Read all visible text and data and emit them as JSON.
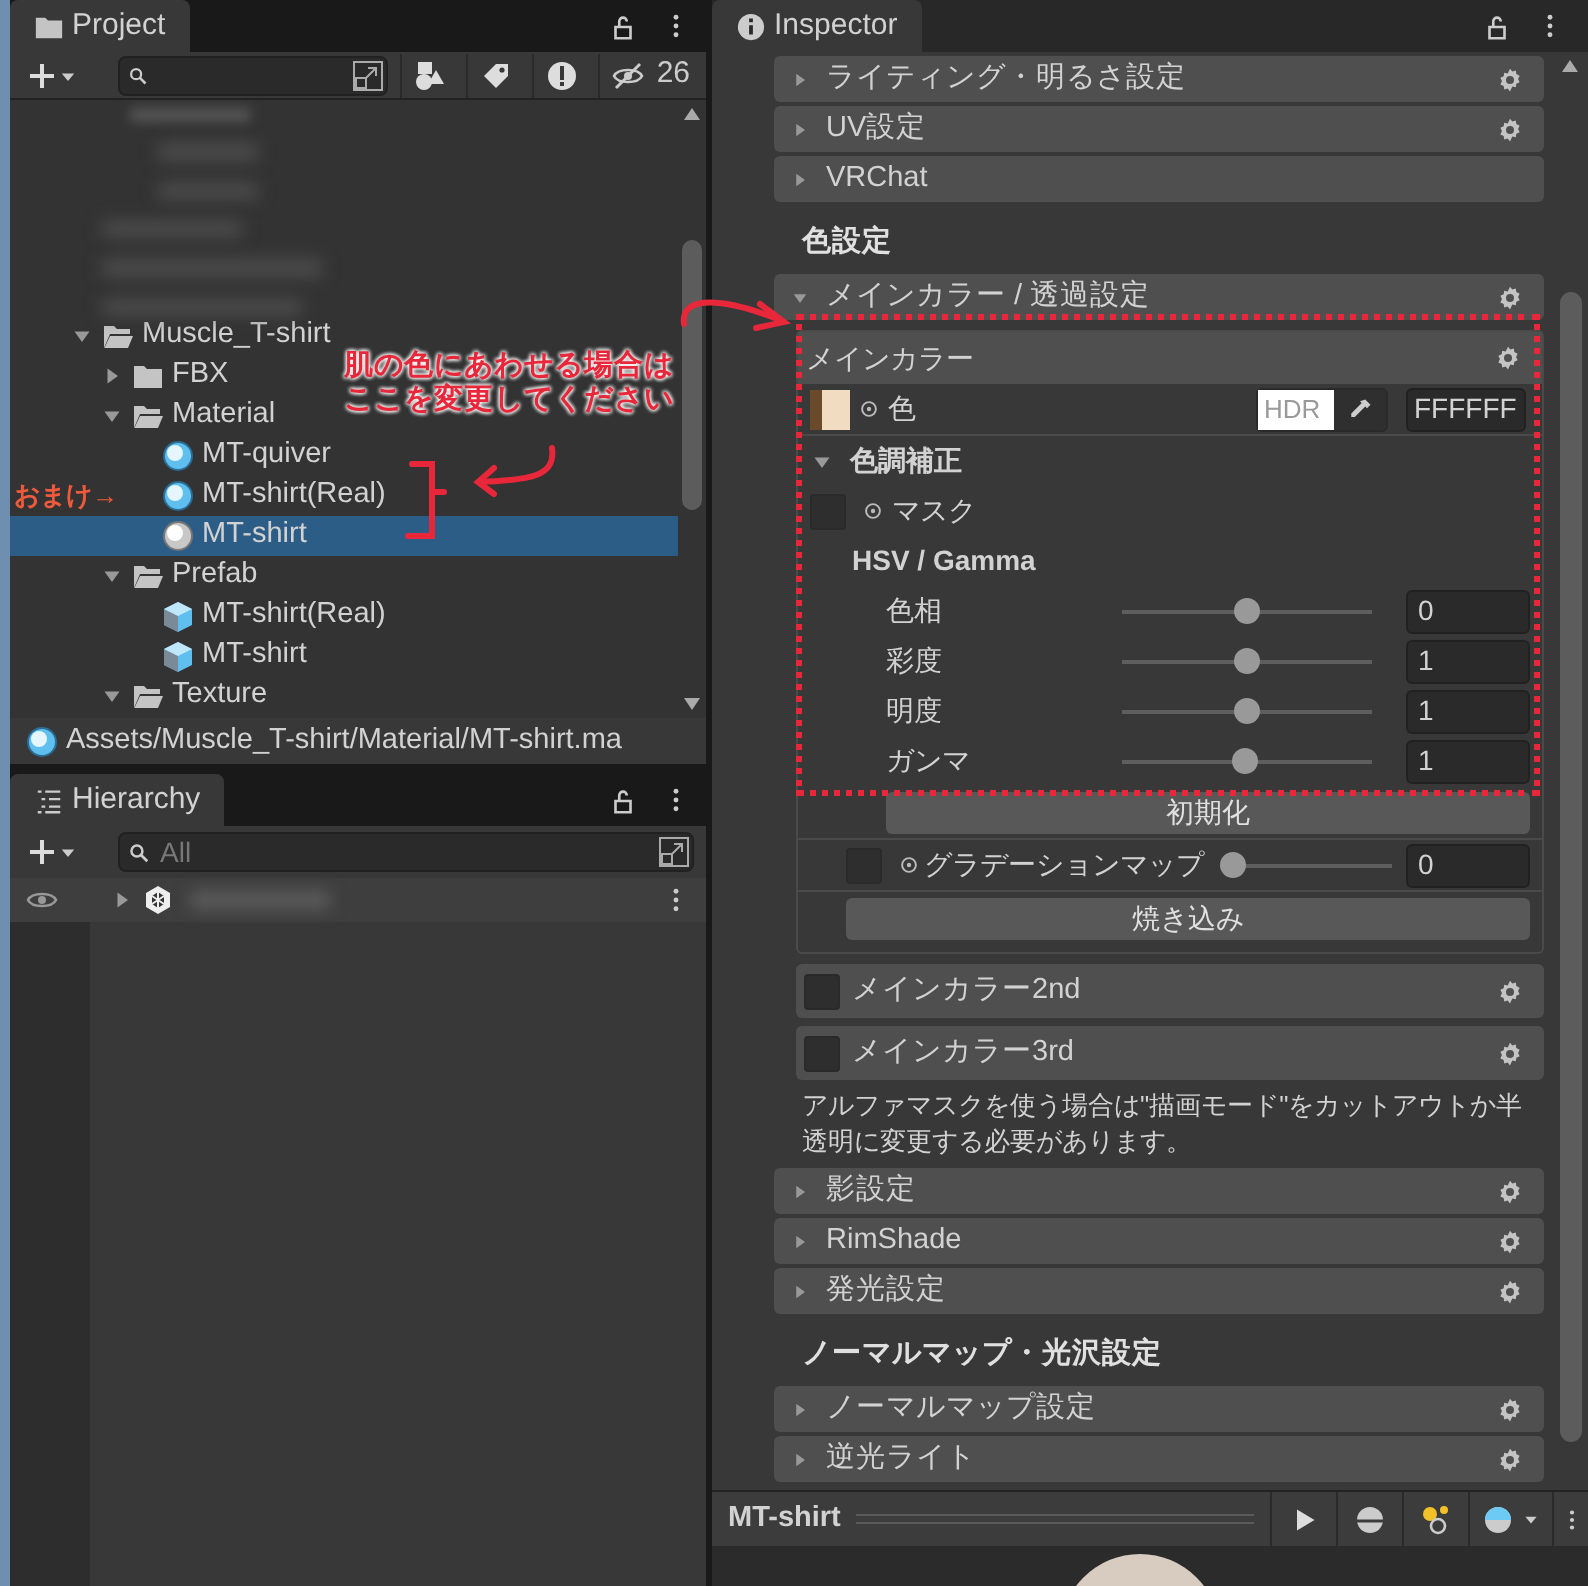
{
  "project_panel": {
    "tab": "Project",
    "hidden_count": "26",
    "tree": [
      {
        "label": "Muscle_T-shirt",
        "kind": "folder",
        "expanded": true,
        "selected": false,
        "children": [
          {
            "label": "FBX",
            "kind": "folder",
            "expanded": false,
            "selected": false
          },
          {
            "label": "Material",
            "kind": "folder",
            "expanded": true,
            "selected": false,
            "children": [
              {
                "label": "MT-quiver",
                "kind": "material",
                "selected": false
              },
              {
                "label": "MT-shirt(Real)",
                "kind": "material",
                "selected": false
              },
              {
                "label": "MT-shirt",
                "kind": "material",
                "selected": true
              }
            ]
          },
          {
            "label": "Prefab",
            "kind": "folder",
            "expanded": true,
            "selected": false,
            "children": [
              {
                "label": "MT-shirt(Real)",
                "kind": "prefab",
                "selected": false
              },
              {
                "label": "MT-shirt",
                "kind": "prefab",
                "selected": false
              }
            ]
          },
          {
            "label": "Texture",
            "kind": "folder",
            "expanded": true,
            "selected": false
          }
        ]
      }
    ],
    "path": "Assets/Muscle_T-shirt/Material/MT-shirt.ma"
  },
  "hierarchy_panel": {
    "tab": "Hierarchy",
    "search": {
      "placeholder": "All"
    }
  },
  "inspector": {
    "tab": "Inspector",
    "items": [
      {
        "kind": "foldout",
        "label": "ライティング・明るさ設定",
        "expanded": false,
        "gear": true
      },
      {
        "kind": "foldout",
        "label": "UV設定",
        "expanded": false,
        "gear": true
      },
      {
        "kind": "foldout",
        "label": "VRChat",
        "expanded": false,
        "gear": false
      },
      {
        "kind": "heading",
        "label": "色設定"
      },
      {
        "kind": "foldout",
        "label": "メインカラー / 透過設定",
        "expanded": true,
        "gear": true
      },
      {
        "kind": "group",
        "title": "メインカラー",
        "rows": [
          {
            "kind": "color",
            "label": "色",
            "hdr": "HDR",
            "hex": "FFFFFF"
          },
          {
            "kind": "subfoldout",
            "label": "色調補正",
            "expanded": true,
            "children": [
              {
                "kind": "checkbox",
                "label": "マスク",
                "checked": false
              },
              {
                "kind": "subheading",
                "label": "HSV / Gamma"
              },
              {
                "kind": "slider",
                "label": "色相",
                "level": 0.5,
                "value": "0"
              },
              {
                "kind": "slider",
                "label": "彩度",
                "level": 0.5,
                "value": "1"
              },
              {
                "kind": "slider",
                "label": "明度",
                "level": 0.5,
                "value": "1"
              },
              {
                "kind": "slider",
                "label": "ガンマ",
                "level": 0.49,
                "value": "1"
              },
              {
                "kind": "button",
                "label": "初期化"
              }
            ]
          },
          {
            "kind": "check_slider",
            "label": "グラデーションマップ",
            "checked": false,
            "level": 0,
            "value": "0"
          },
          {
            "kind": "button",
            "label": "焼き込み"
          }
        ]
      },
      {
        "kind": "toggle_foldout",
        "label": "メインカラー2nd",
        "checked": false
      },
      {
        "kind": "toggle_foldout",
        "label": "メインカラー3rd",
        "checked": false
      },
      {
        "kind": "note",
        "label": "アルファマスクを使う場合は\"描画モード\"をカットアウトか半透明に変更する必要があります。"
      },
      {
        "kind": "foldout",
        "label": "影設定",
        "expanded": false,
        "gear": true
      },
      {
        "kind": "foldout",
        "label": "RimShade",
        "expanded": false,
        "gear": true
      },
      {
        "kind": "foldout",
        "label": "発光設定",
        "expanded": false,
        "gear": true
      },
      {
        "kind": "heading",
        "label": "ノーマルマップ・光沢設定"
      },
      {
        "kind": "foldout",
        "label": "ノーマルマップ設定",
        "expanded": false,
        "gear": true
      },
      {
        "kind": "foldout",
        "label": "逆光ライト",
        "expanded": false,
        "gear": true
      }
    ]
  },
  "preview_bar": {
    "title": "MT-shirt"
  },
  "annotations": [
    {
      "kind": "callout",
      "lines": [
        "肌の色にあわせる場合は",
        "ここを変更してください"
      ]
    },
    {
      "kind": "tag",
      "text": "おまけ→"
    }
  ]
}
